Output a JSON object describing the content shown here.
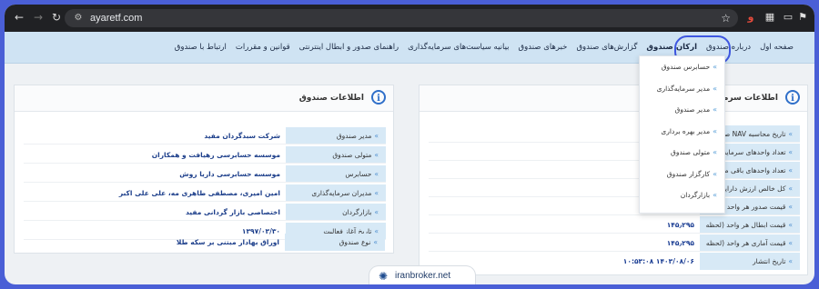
{
  "browser": {
    "url": "ayaretf.com"
  },
  "nav": {
    "items": [
      "صفحه اول",
      "درباره صندوق",
      "ارکان صندوق",
      "گزارش‌های صندوق",
      "خبرهای صندوق",
      "بیانیه سیاست‌های سرمایه‌گذاری",
      "راهنمای صدور و ابطال اینترنتی",
      "قوانین و مقررات",
      "ارتباط با صندوق"
    ]
  },
  "dropdown": {
    "items": [
      "حسابرس صندوق",
      "مدیر سرمایه‌گذاری",
      "مدیر صندوق",
      "مدیر بهره برداری",
      "متولی صندوق",
      "کارگزار صندوق",
      "بازارگردان"
    ]
  },
  "left_panel": {
    "title": "اطلاعات صندوق",
    "rows": [
      {
        "label": "مدیر صندوق",
        "value": "شرکت سبدگردان مفید"
      },
      {
        "label": "متولی صندوق",
        "value": "موسسه حسابرسی رهیافت و همکاران"
      },
      {
        "label": "حسابرس",
        "value": "موسسه حسابرسی داریا روش"
      },
      {
        "label": "مدیران سرمایه‌گذاری",
        "value": "امین امیری، مصطفی طاهری مه، علی علی اکبر"
      },
      {
        "label": "بازارگردان",
        "value": "اختصاصی بازار گردانی مفید"
      },
      {
        "label": "تاریخ آغاز فعالیت",
        "value": "۱۳۹۷/۰۳/۳۰"
      },
      {
        "label": "نوع صندوق",
        "value": "اوراق بهادار مبتنی بر سکه طلا"
      }
    ]
  },
  "right_panel": {
    "title": "اطلاعات سرمایه‌گ",
    "rows": [
      {
        "label": "تاریخ محاسبه NAV صندوق",
        "value": ""
      },
      {
        "label": "تعداد واحدهای سرمایه گ",
        "value": ""
      },
      {
        "label": "تعداد واحدهای باقی ماند",
        "value": ""
      },
      {
        "label": "کل خالص ارزش دارایی‌ها",
        "value": ""
      },
      {
        "label": "قیمت صدور هر واحد (لحظ",
        "value": ""
      },
      {
        "label": "قیمت ابطال هر واحد (لحظه ای)",
        "value": "۱۴۵٫۲۹۵"
      },
      {
        "label": "قیمت آماری هر واحد (لحظه ای)",
        "value": "۱۴۵٫۲۹۵"
      },
      {
        "label": "تاریخ انتشار",
        "value": "۱۴۰۳/۰۸/۰۶ ۱۰:۵۳:۰۸"
      }
    ]
  },
  "watermark": {
    "text": "iranbroker.net"
  }
}
